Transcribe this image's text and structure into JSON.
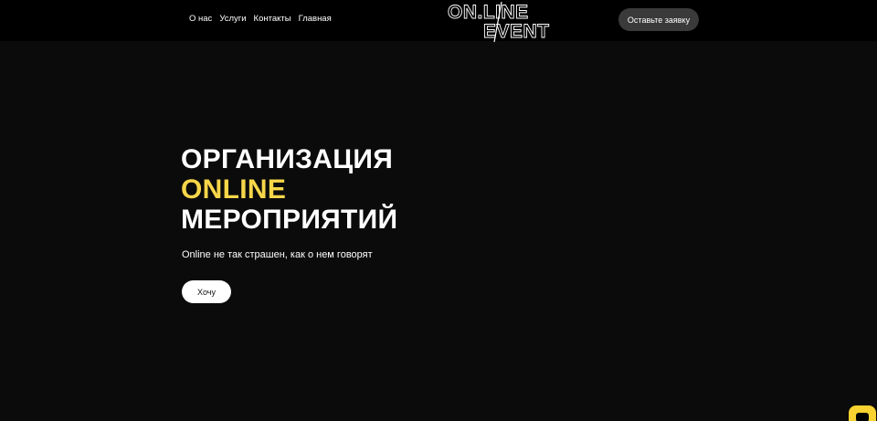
{
  "nav": {
    "items": [
      {
        "label": "О нас"
      },
      {
        "label": "Услуги"
      },
      {
        "label": "Контакты"
      },
      {
        "label": "Главная"
      }
    ]
  },
  "logo": {
    "line1": "ON.LINE",
    "line2": "EVENT"
  },
  "header": {
    "cta_label": "Оставьте заявку"
  },
  "hero": {
    "title_line1": "ОРГАНИЗАЦИЯ",
    "title_line2": "ONLINE",
    "title_line3": "МЕРОПРИЯТИЙ",
    "subtitle": "Online не так страшен, как о нем говорят",
    "button_label": "Хочу"
  },
  "colors": {
    "background": "#0b0b0b",
    "header": "#000000",
    "accent": "#f6d649",
    "widget": "#f7d230"
  },
  "icons": {
    "chat_widget": "chat-icon"
  }
}
